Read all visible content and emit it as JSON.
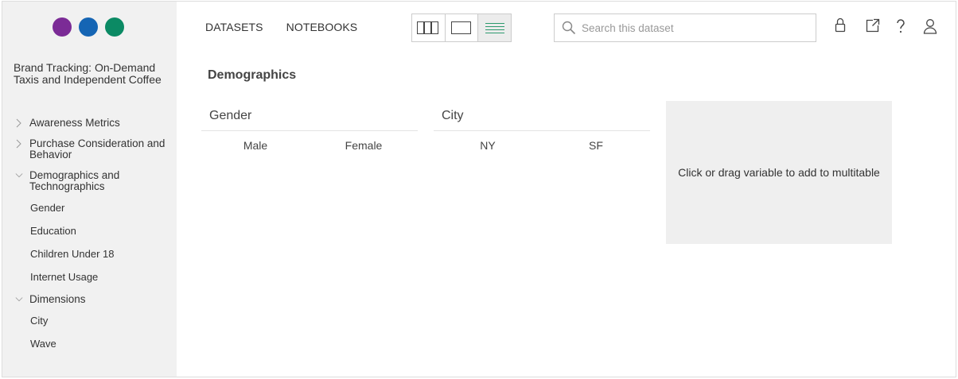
{
  "brand": {
    "dot_colors": [
      "#7b2b96",
      "#1565b4",
      "#0b8a64"
    ]
  },
  "dataset": {
    "title": "Brand Tracking: On-Demand Taxis and Independent Coffee"
  },
  "sidebar": {
    "groups": [
      {
        "label": "Awareness Metrics",
        "state": "collapsed"
      },
      {
        "label": "Purchase Consideration and Behavior",
        "state": "collapsed"
      },
      {
        "label": "Demographics and Technographics",
        "state": "expanded",
        "items": [
          "Gender",
          "Education",
          "Children Under 18",
          "Internet Usage"
        ]
      },
      {
        "label": "Dimensions",
        "state": "expanded",
        "items": [
          "City",
          "Wave"
        ]
      }
    ]
  },
  "topnav": {
    "datasets": "DATASETS",
    "notebooks": "NOTEBOOKS"
  },
  "view_switcher": {
    "options": [
      "columns-view-icon",
      "single-view-icon",
      "list-view-icon"
    ],
    "active": "list-view-icon",
    "active_color": "#2e9a6e"
  },
  "search": {
    "placeholder": "Search this dataset",
    "value": ""
  },
  "toolbar_icons": [
    "lock-icon",
    "export-icon",
    "help-icon",
    "user-icon"
  ],
  "main": {
    "heading": "Demographics",
    "variables": [
      {
        "title": "Gender",
        "categories": [
          "Male",
          "Female"
        ]
      },
      {
        "title": "City",
        "categories": [
          "NY",
          "SF"
        ]
      }
    ],
    "drop_zone": "Click or drag variable to add to multitable"
  }
}
